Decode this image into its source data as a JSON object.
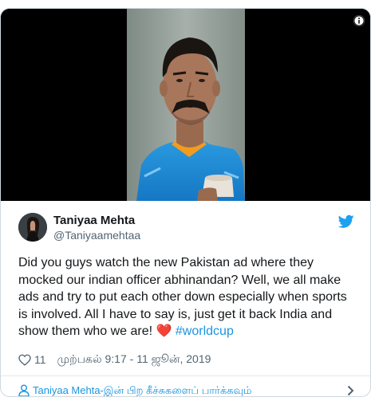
{
  "tweet": {
    "author": {
      "display_name": "Taniyaa Mehta",
      "handle": "@Taniyaamehtaa",
      "avatar_icon": "profile-photo"
    },
    "text": "Did you guys watch the new Pakistan ad where they mocked our indian officer abhinandan? Well, we all make ads and try to put each other down especially when sports is involved. All I have to say is, just get it back India and show them who we are!",
    "emoji": "❤️",
    "hashtag": "#worldcup",
    "likes": "11",
    "timestamp": "முற்பகல் 9:17 - 11 ஜூன், 2019",
    "more_link": "Taniyaa Mehta-இன் பிற கீச்சுகளைப் பார்க்கவும்"
  },
  "icons": {
    "info": "info-icon",
    "brand": "twitter-bird-icon",
    "like": "heart-outline-icon",
    "person": "person-icon",
    "chevron": "chevron-right-icon"
  },
  "colors": {
    "accent": "#1b95e0",
    "heart": "#e0245e",
    "text": "#14171a",
    "muted": "#536471",
    "border": "#cfd9de",
    "jersey": "#1e8ed6"
  }
}
